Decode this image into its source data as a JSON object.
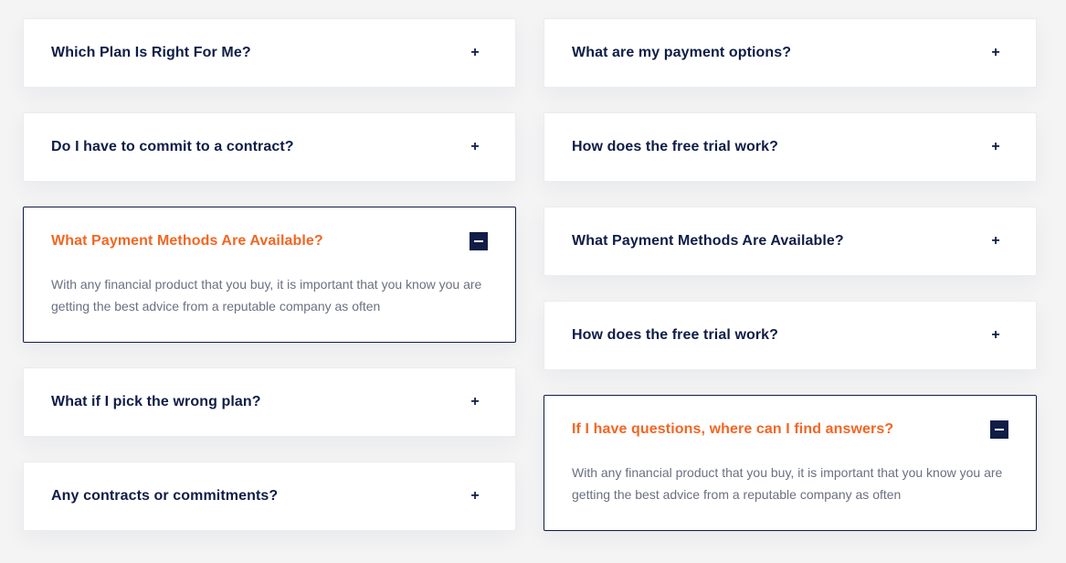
{
  "left_column": [
    {
      "question": "Which Plan Is Right For Me?",
      "icon": "plus-icon",
      "toggle": "+"
    },
    {
      "question": "Do I have to commit to a contract?",
      "icon": "plus-icon",
      "toggle": "+"
    },
    {
      "question": "What Payment Methods Are Available?",
      "icon": "minus-icon",
      "open": true,
      "answer": "With any financial product that you buy, it is important that you know you are getting the best advice from a reputable company as often"
    },
    {
      "question": "What if I pick the wrong plan?",
      "icon": "plus-icon",
      "toggle": "+"
    },
    {
      "question": "Any contracts or commitments?",
      "icon": "plus-icon",
      "toggle": "+"
    }
  ],
  "right_column": [
    {
      "question": "What are my payment options?",
      "icon": "plus-icon",
      "toggle": "+"
    },
    {
      "question": "How does the free trial work?",
      "icon": "plus-icon",
      "toggle": "+"
    },
    {
      "question": "What Payment Methods Are Available?",
      "icon": "plus-icon",
      "toggle": "+"
    },
    {
      "question": "How does the free trial work?",
      "icon": "plus-icon",
      "toggle": "+"
    },
    {
      "question": "If I have questions, where can I find answers?",
      "icon": "minus-icon",
      "open": true,
      "answer": "With any financial product that you buy, it is important that you know you are getting the best advice from a reputable company as often"
    }
  ],
  "colors": {
    "navy": "#0f1d47",
    "accent_orange": "#f26622",
    "body_text": "#6b7080",
    "background": "#f4f4f5"
  }
}
